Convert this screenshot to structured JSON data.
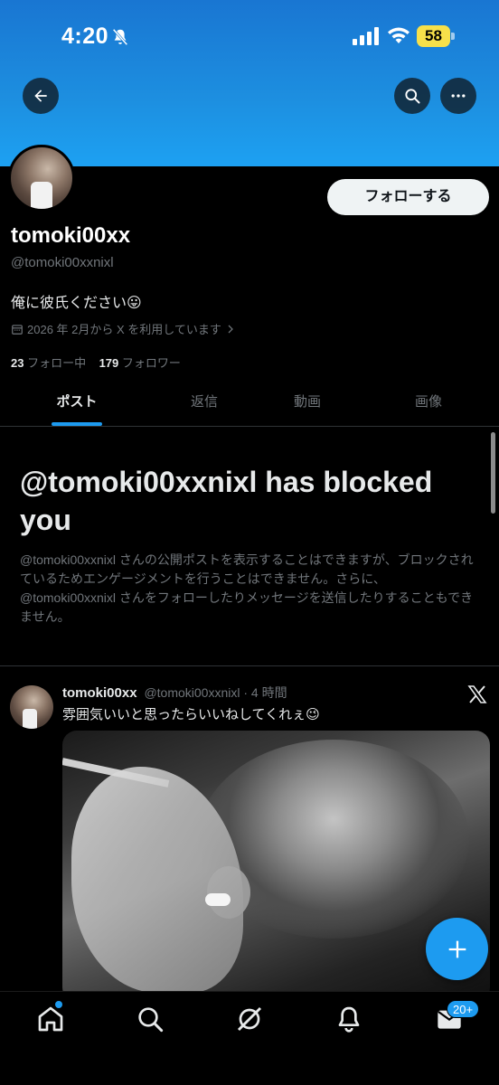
{
  "status_bar": {
    "time": "4:20",
    "battery": "58"
  },
  "header": {
    "back_icon": "arrow-left-icon",
    "search_icon": "search-icon",
    "more_icon": "more-horizontal-icon"
  },
  "profile": {
    "follow_label": "フォローする",
    "display_name": "tomoki00xx",
    "handle": "@tomoki00xxnixl",
    "bio": "俺に彼氏ください😛",
    "joined": "2026 年 2月から X を利用しています",
    "following_count": "23",
    "following_label": "フォロー中",
    "followers_count": "179",
    "followers_label": "フォロワー"
  },
  "tabs": [
    {
      "label": "ポスト",
      "active": true
    },
    {
      "label": "返信",
      "active": false
    },
    {
      "label": "動画",
      "active": false
    },
    {
      "label": "画像",
      "active": false
    }
  ],
  "blocked": {
    "title": "@tomoki00xxnixl has blocked you",
    "description": "@tomoki00xxnixl さんの公開ポストを表示することはできますが、ブロックされているためエンゲージメントを行うことはできません。さらに、@tomoki00xxnixl さんをフォローしたりメッセージを送信したりすることもできません。"
  },
  "post": {
    "name": "tomoki00xx",
    "handle": "@tomoki00xxnixl",
    "time": "· 4 時間",
    "text": "雰囲気いいと思ったらいいねしてくれぇ😉"
  },
  "bottom_nav": {
    "items": [
      "home-icon",
      "search-icon",
      "grok-icon",
      "bell-icon",
      "mail-icon"
    ],
    "messages_badge": "20+"
  },
  "colors": {
    "accent": "#1d9bf0",
    "banner": "#1d8fe0",
    "muted": "#71767b"
  }
}
